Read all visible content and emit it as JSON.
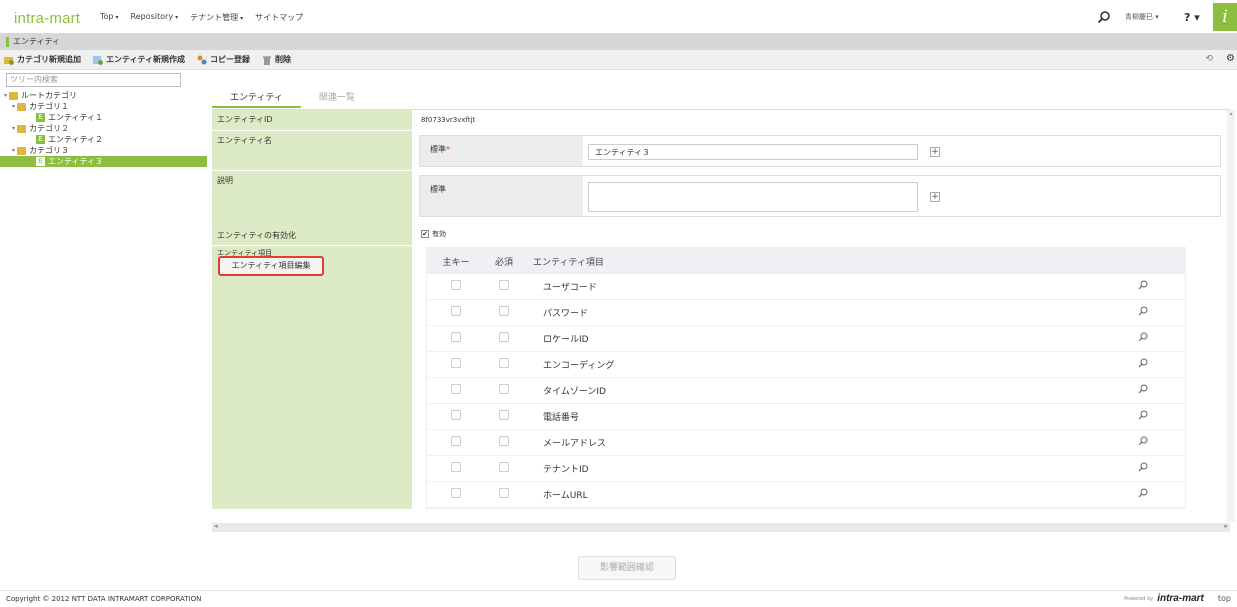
{
  "header": {
    "logo": "intra-mart",
    "menu": [
      "Top",
      "Repository",
      "テナント管理",
      "サイトマップ"
    ],
    "menu_caret": [
      "▾",
      "▾",
      "▾",
      ""
    ],
    "user": "青柳慶巳 ▾",
    "help": "? ▾",
    "badge": "i"
  },
  "window_title": "エンティティ",
  "toolbar": {
    "add_category": "カテゴリ新規追加",
    "new_entity": "エンティティ新規作成",
    "copy": "コピー登録",
    "delete": "削除",
    "right_icon": "⟲",
    "right_icon2": "⚙"
  },
  "sidebar": {
    "search_placeholder": "ツリー内検索",
    "root": "ルートカテゴリ",
    "cat1": "カテゴリ１",
    "ent1": "エンティティ１",
    "cat2": "カテゴリ２",
    "ent2": "エンティティ２",
    "cat3": "カテゴリ３",
    "ent3": "エンティティ３",
    "ent_icon": "E"
  },
  "tabs": [
    "エンティティ",
    "関連一覧"
  ],
  "form": {
    "id_label": "エンティティID",
    "id_value": "8f0733vr3vxftjt",
    "name_label": "エンティティ名",
    "lang_label": "標準",
    "required_mark": "*",
    "name_value": "エンティティ３",
    "desc_label": "説明",
    "desc_value": "",
    "plus": "+",
    "enable_label": "エンティティの有効化",
    "enable_value": "有効",
    "enable_check": "✔",
    "items_label": "エンティティ項目",
    "edit_button": "エンティティ項目編集"
  },
  "grid": {
    "headers": [
      "主キー",
      "必須",
      "エンティティ項目"
    ],
    "rows": [
      "ユーザコード",
      "パスワード",
      "ロケールID",
      "エンコーディング",
      "タイムゾーンID",
      "電話番号",
      "メールアドレス",
      "テナントID",
      "ホームURL"
    ]
  },
  "scroll_arrows": {
    "up": "▴",
    "down": "▾",
    "left": "◂",
    "right": "▸"
  },
  "impact_button": "影響範囲確認",
  "footer": {
    "copyright": "Copyright © 2012 NTT DATA INTRAMART CORPORATION",
    "powered": "Powered by",
    "brand": "intra-mart",
    "top": "top"
  },
  "colors": {
    "accent": "#8cbf3f",
    "label_bg": "#dcebc5",
    "highlight": "#e2402f"
  }
}
